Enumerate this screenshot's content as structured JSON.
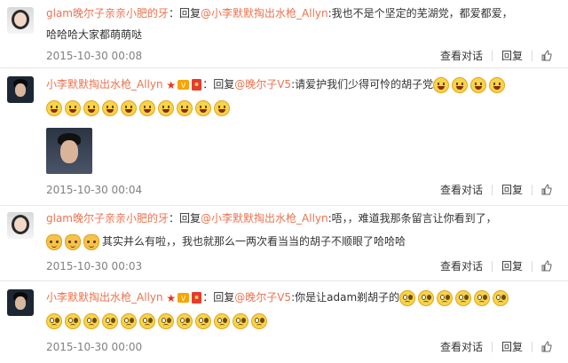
{
  "comments": [
    {
      "author": "glam晚尔子亲亲小肥的牙",
      "reply_word": "回复",
      "at_user": "@小李默默掏出水枪_Allyn",
      "text_line1": ":我也不是个坚定的芜湖党，都爱都爱，",
      "text_line2": "哈哈哈大家都萌萌哒",
      "date": "2015-10-30 00:08",
      "actions": {
        "view": "查看对话",
        "reply": "回复"
      }
    },
    {
      "author": "小李默默掏出水枪_Allyn",
      "reply_word": "回复",
      "at_user": "@晚尔子V5",
      "text_line1": ":请爱护我们少得可怜的胡子党",
      "emoji_name": "grin-emoji",
      "emoji_count_line1": 4,
      "emoji_count_line2": 10,
      "date": "2015-10-30 00:04",
      "actions": {
        "view": "查看对话",
        "reply": "回复"
      }
    },
    {
      "author": "glam晚尔子亲亲小肥的牙",
      "reply_word": "回复",
      "at_user": "@小李默默掏出水枪_Allyn",
      "text_line1": ":唔，，难道我那条留言让你看到了，",
      "text_line2": "其实并么有啦，，我也就那么一两次看当当的胡子不顺眼了哈哈哈",
      "emoji_name": "cat-emoji",
      "emoji_count_line2": 3,
      "date": "2015-10-30 00:03",
      "actions": {
        "view": "查看对话",
        "reply": "回复"
      }
    },
    {
      "author": "小李默默掏出水枪_Allyn",
      "reply_word": "回复",
      "at_user": "@晚尔子V5",
      "text_line1": ":你是让adam剃胡子的",
      "emoji_name": "frown-emoji",
      "emoji_count_line1": 6,
      "emoji_count_line2": 12,
      "date": "2015-10-30 00:00",
      "actions": {
        "view": "查看对话",
        "reply": "回复"
      }
    }
  ],
  "colors": {
    "link": "#eb7350",
    "date": "#808080",
    "separator": "#e6e6e6"
  },
  "icons": [
    "like-icon",
    "red-star-icon",
    "vip-badge-icon",
    "red-envelope-icon"
  ]
}
